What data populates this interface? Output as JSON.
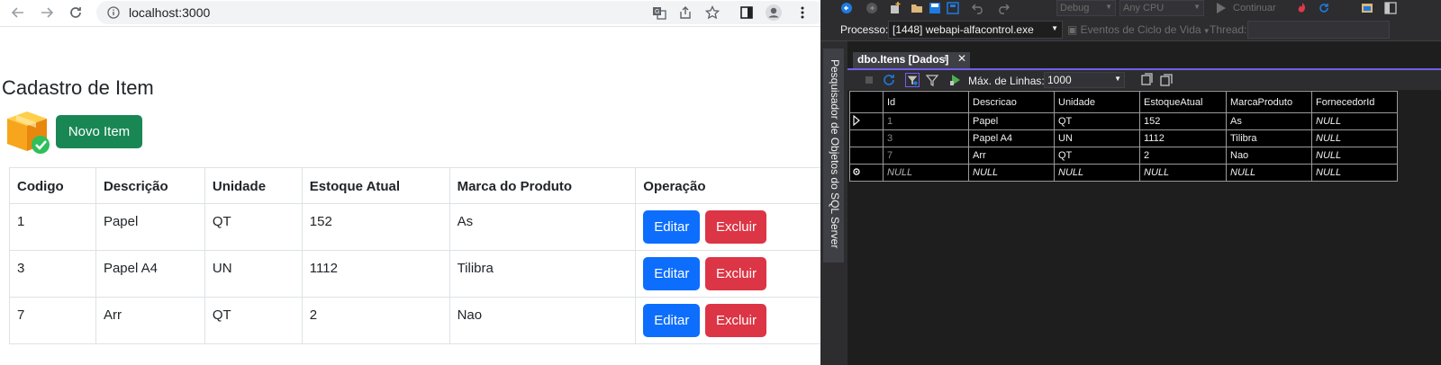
{
  "browser": {
    "url": "localhost:3000"
  },
  "page": {
    "title": "Cadastro de Item",
    "new_button_label": "Novo Item",
    "columns": [
      "Codigo",
      "Descrição",
      "Unidade",
      "Estoque Atual",
      "Marca do Produto",
      "Operação"
    ],
    "rows": [
      {
        "codigo": "1",
        "descricao": "Papel",
        "unidade": "QT",
        "estoque": "152",
        "marca": "As"
      },
      {
        "codigo": "3",
        "descricao": "Papel A4",
        "unidade": "UN",
        "estoque": "1112",
        "marca": "Tilibra"
      },
      {
        "codigo": "7",
        "descricao": "Arr",
        "unidade": "QT",
        "estoque": "2",
        "marca": "Nao"
      }
    ],
    "edit_label": "Editar",
    "delete_label": "Excluir",
    "colors": {
      "success": "#198754",
      "primary": "#0d6efd",
      "danger": "#dc3545"
    }
  },
  "vs": {
    "config_combo": "Debug",
    "platform_combo": "Any CPU",
    "continue_label": "Continuar",
    "process_label": "Processo:",
    "process_value": "[1448] webapi-alfacontrol.exe",
    "lifecycle_label": "Eventos de Ciclo de Vida",
    "thread_label": "Thread:",
    "sidebar_label": "Pesquisador de Objetos do SQL Server",
    "tab_title": "dbo.Itens [Dados]",
    "max_rows_label": "Máx. de Linhas:",
    "max_rows_value": "1000",
    "grid_columns": [
      "Id",
      "Descricao",
      "Unidade",
      "EstoqueAtual",
      "MarcaProduto",
      "FornecedorId"
    ],
    "grid_rows": [
      [
        "1",
        "Papel",
        "QT",
        "152",
        "As",
        "NULL"
      ],
      [
        "3",
        "Papel A4",
        "UN",
        "1112",
        "Tilibra",
        "NULL"
      ],
      [
        "7",
        "Arr",
        "QT",
        "2",
        "Nao",
        "NULL"
      ]
    ],
    "new_row": [
      "NULL",
      "NULL",
      "NULL",
      "NULL",
      "NULL",
      "NULL"
    ],
    "colors": {
      "accent": "#7160e8",
      "background": "#1e1e1e",
      "chrome": "#2d2d30"
    }
  }
}
